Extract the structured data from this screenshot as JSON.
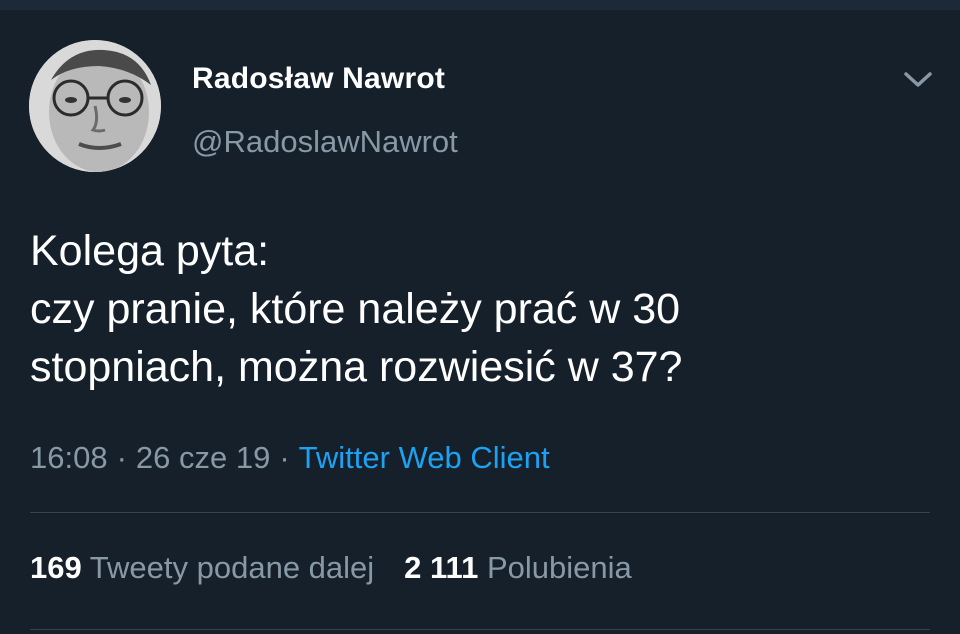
{
  "tweet": {
    "display_name": "Radosław Nawrot",
    "handle": "@RadoslawNawrot",
    "text": "Kolega pyta:\nczy pranie, które należy prać w 30\nstopniach, można rozwiesić w 37?",
    "time": "16:08",
    "date": "26 cze 19",
    "separator": "·",
    "source": "Twitter Web Client",
    "retweets_count": "169",
    "retweets_label": "Tweety podane dalej",
    "likes_count": "2 111",
    "likes_label": "Polubienia"
  },
  "colors": {
    "background": "#15202b",
    "text_primary": "#ffffff",
    "text_secondary": "#8899a6",
    "link": "#1da1f2",
    "divider": "#38444d"
  },
  "icons": {
    "menu": "chevron-down-icon"
  }
}
